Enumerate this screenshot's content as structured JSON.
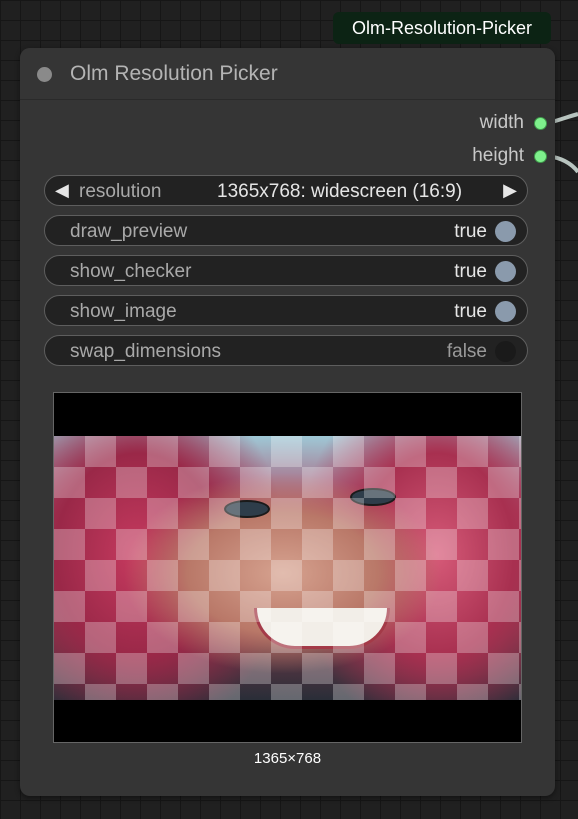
{
  "badge": {
    "label": "Olm-Resolution-Picker"
  },
  "node": {
    "title": "Olm Resolution Picker",
    "outputs": [
      {
        "label": "width"
      },
      {
        "label": "height"
      }
    ],
    "resolution": {
      "label": "resolution",
      "value": "1365x768: widescreen (16:9)",
      "prev": "◀",
      "next": "▶"
    },
    "toggles": [
      {
        "label": "draw_preview",
        "value": "true",
        "on": true
      },
      {
        "label": "show_checker",
        "value": "true",
        "on": true
      },
      {
        "label": "show_image",
        "value": "true",
        "on": true
      },
      {
        "label": "swap_dimensions",
        "value": "false",
        "on": false
      }
    ],
    "preview_caption": "1365×768"
  },
  "colors": {
    "port": "#7ef08c",
    "knob_on": "#8a9aac",
    "knob_off": "#1a1a1a",
    "badge_bg": "#0c2314"
  }
}
